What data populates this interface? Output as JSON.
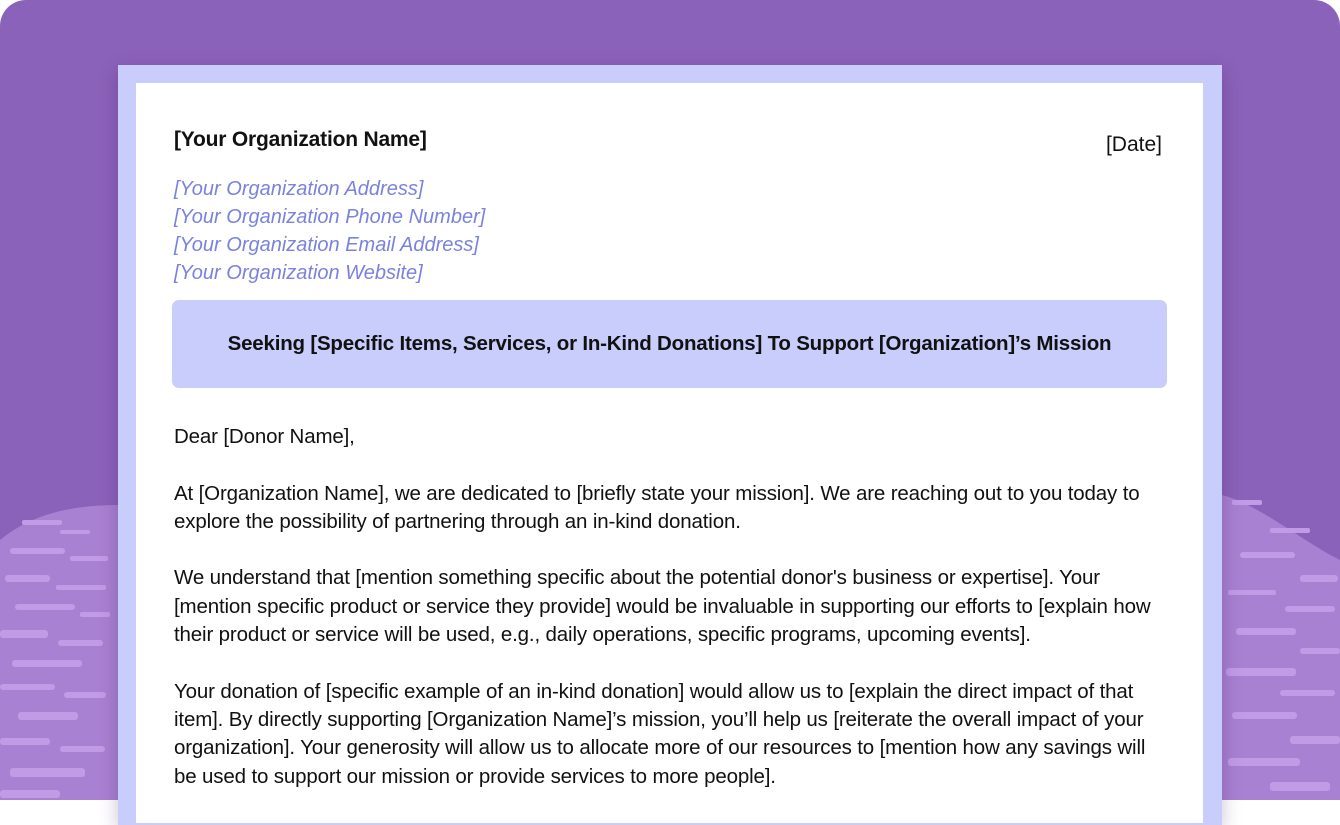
{
  "letter": {
    "organization_name": "[Your Organization Name]",
    "date": "[Date]",
    "contact": {
      "address": "[Your Organization Address]",
      "phone": "[Your Organization Phone Number]",
      "email": "[Your Organization Email Address]",
      "website": "[Your Organization Website]"
    },
    "subject": "Seeking [Specific Items, Services, or In-Kind Donations] To Support [Organization]’s Mission",
    "salutation": "Dear [Donor Name],",
    "paragraphs": [
      "At [Organization Name], we are dedicated to [briefly state your mission]. We are reaching out to you today to explore the possibility of partnering through an in-kind donation.",
      "We understand that [mention something specific about the potential donor's business or expertise]. Your [mention specific product or service they provide] would be invaluable in supporting our efforts to [explain how their product or service will be used, e.g., daily operations, specific programs, upcoming events].",
      "Your donation of [specific example of an in-kind donation] would allow us to [explain the direct impact of that item]. By directly supporting [Organization Name]’s mission, you’ll help us [reiterate the overall impact of your organization]. Your generosity will allow us to allocate more of our resources to [mention how any savings will be used to support our mission or provide services to more people]."
    ]
  },
  "colors": {
    "background": "#8b62b9",
    "frame": "#c8cdfb",
    "contact_text": "#7a82de",
    "texture": "#c9a2ec"
  }
}
